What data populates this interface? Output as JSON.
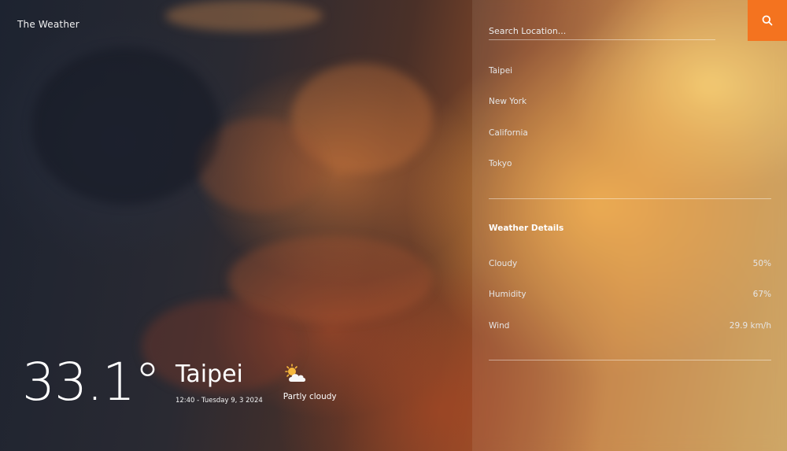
{
  "app": {
    "brand": "The Weather"
  },
  "current": {
    "temperature": "33.1°",
    "city": "Taipei",
    "datetime": "12:40 - Tuesday 9, 3 2024",
    "condition": "Partly cloudy",
    "condition_icon": "partly-cloudy-icon"
  },
  "search": {
    "placeholder": "Search Location...",
    "value": "",
    "button_icon": "search-icon"
  },
  "locations": [
    "Taipei",
    "New York",
    "California",
    "Tokyo"
  ],
  "details": {
    "title": "Weather Details",
    "rows": [
      {
        "label": "Cloudy",
        "value": "50%"
      },
      {
        "label": "Humidity",
        "value": "67%"
      },
      {
        "label": "Wind",
        "value": "29.9 km/h"
      }
    ]
  },
  "colors": {
    "accent": "#f4731f"
  }
}
